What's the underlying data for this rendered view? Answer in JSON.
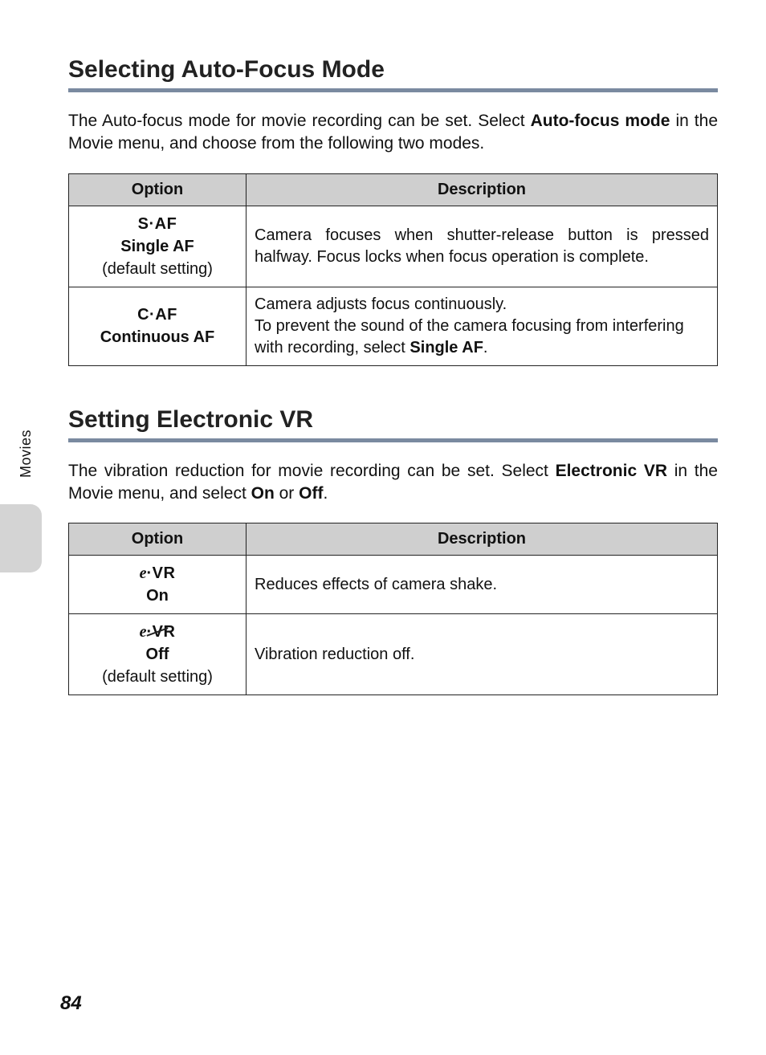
{
  "side_tab": "Movies",
  "page_number": "84",
  "section1": {
    "heading": "Selecting Auto-Focus Mode",
    "intro_parts": {
      "p1": "The Auto-focus mode for movie recording can be set. Select ",
      "b1": "Auto-focus mode",
      "p2": " in the Movie menu, and choose from the following two modes."
    },
    "table": {
      "headers": {
        "option": "Option",
        "description": "Description"
      },
      "rows": [
        {
          "icon": "S·AF",
          "label": "Single AF",
          "note": "(default setting)",
          "desc": "Camera focuses when shutter-release button is pressed halfway. Focus locks when focus operation is complete."
        },
        {
          "icon": "C·AF",
          "label": "Continuous AF",
          "desc_parts": {
            "p1": "Camera adjusts focus continuously.",
            "p2a": "To prevent the sound of the camera focusing from interfering with recording, select ",
            "b": "Single AF",
            "p2b": "."
          }
        }
      ]
    }
  },
  "section2": {
    "heading": "Setting Electronic VR",
    "intro_parts": {
      "p1": "The vibration reduction for movie recording can be set. Select ",
      "b1": "Electronic VR",
      "p2": " in the Movie menu, and select ",
      "b2": "On",
      "p3": " or ",
      "b3": "Off",
      "p4": "."
    },
    "table": {
      "headers": {
        "option": "Option",
        "description": "Description"
      },
      "rows": [
        {
          "icon_prefix": "e",
          "icon_suffix": "·VR",
          "label": "On",
          "desc": "Reduces effects of camera shake."
        },
        {
          "icon_prefix": "e",
          "icon_suffix": "·VR",
          "label": "Off",
          "note": "(default setting)",
          "desc": "Vibration reduction off."
        }
      ]
    }
  }
}
